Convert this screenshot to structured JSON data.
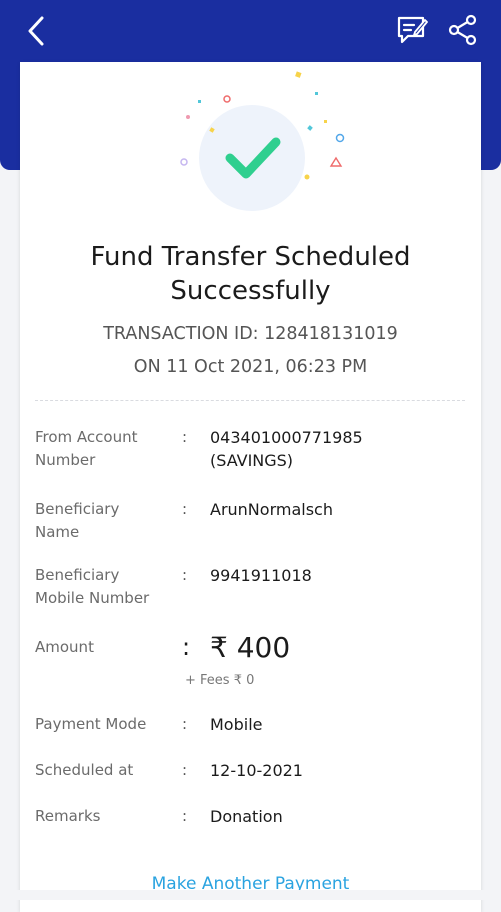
{
  "header": {
    "back_icon": "back-arrow-icon",
    "chat_icon": "message-edit-icon",
    "share_icon": "share-icon",
    "bg_color": "#1a2ea0"
  },
  "status": {
    "icon": "success-check-icon",
    "check_color": "#2fcf8f",
    "title_line1": "Fund Transfer Scheduled",
    "title_line2": "Successfully",
    "transaction_id_line": "TRANSACTION ID: 128418131019",
    "date_line": "ON 11 Oct 2021, 06:23 PM"
  },
  "details": {
    "from_account": {
      "label_line1": "From Account",
      "label_line2": "Number",
      "colon": ":",
      "value_line1": "043401000771985",
      "value_line2": "(SAVINGS)"
    },
    "beneficiary_name": {
      "label_line1": "Beneficiary",
      "label_line2": "Name",
      "colon": ":",
      "value": "ArunNormalsch"
    },
    "beneficiary_mobile": {
      "label_line1": "Beneficiary",
      "label_line2": "Mobile Number",
      "colon": ":",
      "value": "9941911018"
    },
    "amount": {
      "label": "Amount",
      "colon": ":",
      "value": "₹ 400",
      "fees": "+ Fees ₹ 0"
    },
    "payment_mode": {
      "label": "Payment Mode",
      "colon": ":",
      "value": "Mobile"
    },
    "scheduled_at": {
      "label": "Scheduled at",
      "colon": ":",
      "value": "12-10-2021"
    },
    "remarks": {
      "label": "Remarks",
      "colon": ":",
      "value": "Donation"
    }
  },
  "actions": {
    "make_another_payment": "Make Another Payment",
    "link_color": "#2aa3e0"
  }
}
